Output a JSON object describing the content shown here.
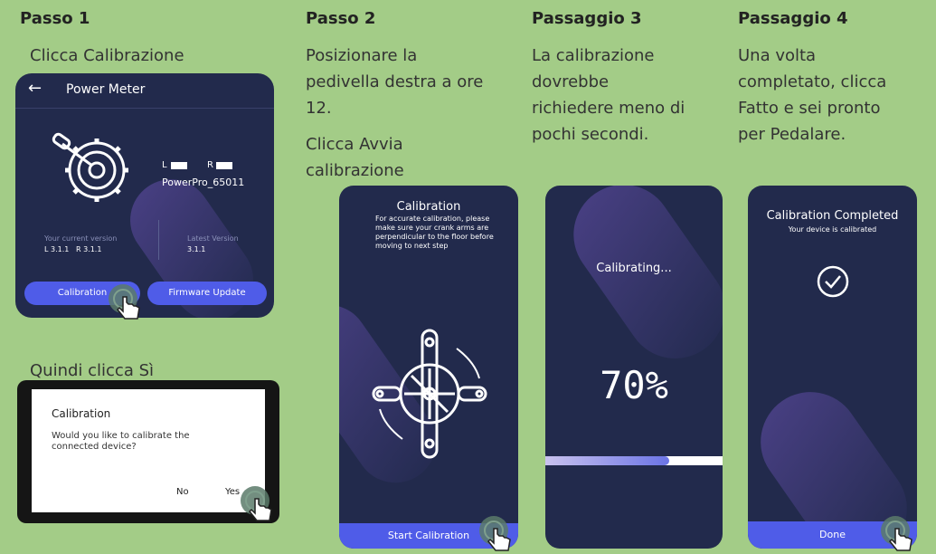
{
  "steps": [
    {
      "title": "Passo 1",
      "text": "Clicca Calibrazione",
      "text2": "Quindi clicca Sì"
    },
    {
      "title": "Passo 2",
      "text_lines": [
        "Posizionare la",
        "pedivella destra a ore",
        "12."
      ],
      "text2_lines": [
        "Clicca Avvia",
        "calibrazione"
      ]
    },
    {
      "title": "Passaggio 3",
      "text_lines": [
        "La calibrazione",
        "dovrebbe",
        "richiedere meno di",
        "pochi secondi."
      ]
    },
    {
      "title": "Passaggio 4",
      "text_lines": [
        "Una volta",
        "completato, clicca",
        "Fatto e sei pronto",
        "per Pedalare."
      ]
    }
  ],
  "power_meter": {
    "title": "Power Meter",
    "left_label": "L",
    "right_label": "R",
    "device_name": "PowerPro_65011",
    "current_version_label": "Your current version",
    "current_version_value": "L 3.1.1   R 3.1.1",
    "latest_version_label": "Latest Version",
    "latest_version_value": "3.1.1",
    "calibration_button": "Calibration",
    "firmware_button": "Firmware Update"
  },
  "dialog": {
    "title": "Calibration",
    "message": "Would you like to calibrate the connected device?",
    "no": "No",
    "yes": "Yes"
  },
  "calibration_screen": {
    "title": "Calibration",
    "instructions": "For accurate calibration, please make sure your crank arms are perpendicular to the floor before moving to next step",
    "start_button": "Start Calibration"
  },
  "progress_screen": {
    "status": "Calibrating...",
    "percent_text": "70%",
    "progress": 0.7
  },
  "completed_screen": {
    "title": "Calibration Completed",
    "subtitle": "Your device is calibrated",
    "done_button": "Done"
  },
  "colors": {
    "background": "#a3cc87",
    "phone_bg": "#222a4c",
    "accent": "#4f5ce8"
  }
}
